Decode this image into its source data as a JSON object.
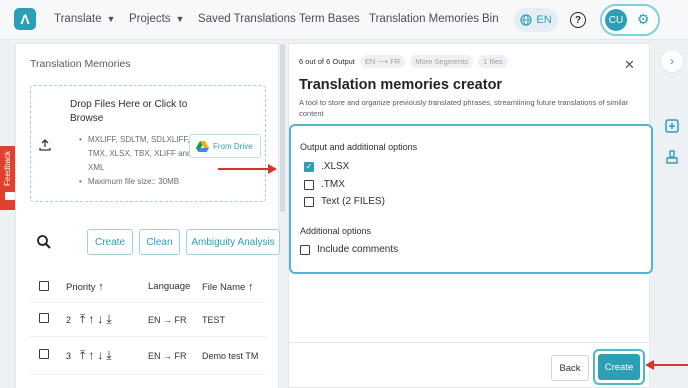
{
  "nav": {
    "logo": "Λ",
    "items": [
      {
        "label": "Translate",
        "has_dropdown": true
      },
      {
        "label": "Projects",
        "has_dropdown": true
      },
      {
        "label": "Saved Translations"
      },
      {
        "label": "Term Bases"
      },
      {
        "label": "Translation Memories"
      },
      {
        "label": "Bin"
      }
    ],
    "language": "EN",
    "help": "?",
    "avatar_initials": "CU"
  },
  "left_panel": {
    "title": "Translation Memories",
    "dropzone": {
      "title": "Drop Files Here or Click to Browse",
      "formats": "MXLIFF, SDLTM, SDLXLIFF, TMX, XLSX, TBX, XLIFF and XML",
      "max_size": "Maximum file size:: 30MB",
      "from_drive": "From Drive"
    },
    "actions": {
      "create": "Create",
      "clean": "Clean",
      "ambiguity": "Ambiguity Analysis"
    },
    "table": {
      "headers": {
        "priority": "Priority",
        "language": "Language",
        "file_name": "File Name"
      },
      "rows": [
        {
          "priority": "2",
          "source": "EN",
          "target": "FR",
          "file_name": "TEST"
        },
        {
          "priority": "3",
          "source": "EN",
          "target": "FR",
          "file_name": "Demo test TM"
        }
      ]
    }
  },
  "modal": {
    "crumbs": {
      "output": "6 out of 6 Output",
      "lang": "EN ⟶ FR",
      "segments": "More Segments",
      "files": "1 files"
    },
    "title": "Translation memories creator",
    "subtitle": "A tool to store and organize previously translated phrases, streamlining future translations of similar content",
    "output_heading": "Output and additional options",
    "outputs": [
      {
        "label": ".XLSX",
        "checked": true
      },
      {
        "label": ".TMX",
        "checked": false
      },
      {
        "label": "Text (2 FILES)",
        "checked": false
      }
    ],
    "additional_heading": "Additional options",
    "additional": [
      {
        "label": "Include comments",
        "checked": false
      }
    ],
    "back": "Back",
    "create": "Create"
  },
  "feedback": {
    "label": "Feedback"
  },
  "colors": {
    "accent": "#2c9fb7",
    "annotation": "#d9342b",
    "feedback": "#e0402e"
  }
}
